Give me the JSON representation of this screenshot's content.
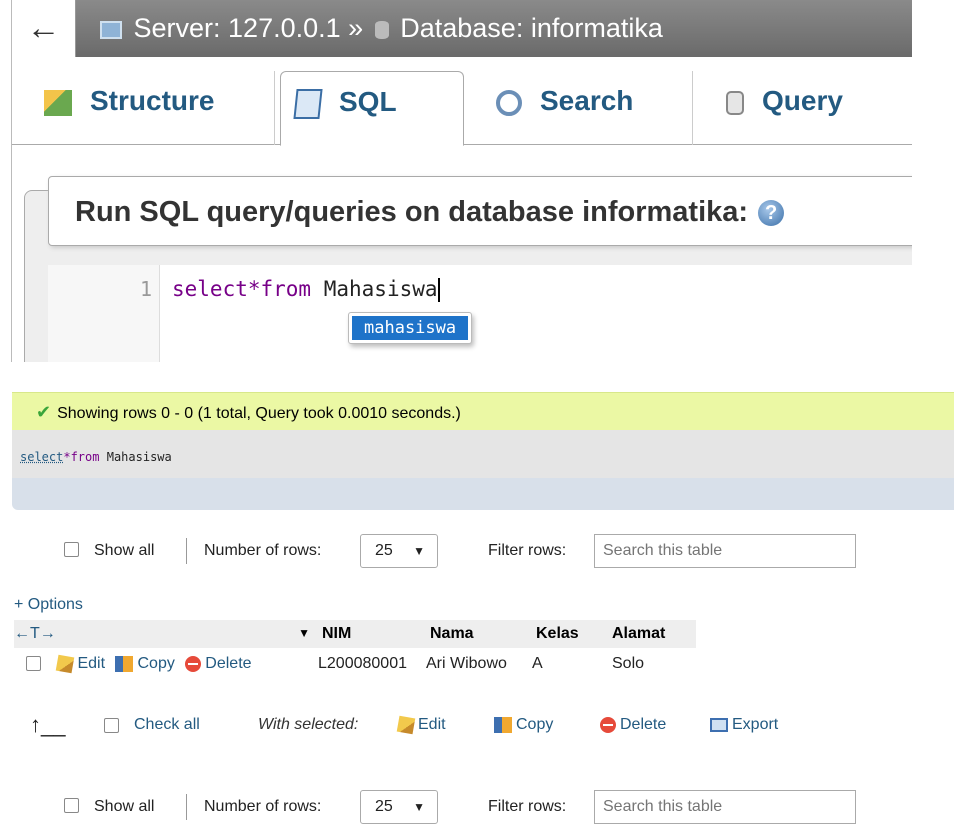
{
  "breadcrumb": {
    "back": "←",
    "server": "Server: 127.0.0.1",
    "sep": "»",
    "database": "Database: informatika"
  },
  "tabs": [
    {
      "label": "Structure",
      "icon": "structure-icon"
    },
    {
      "label": "SQL",
      "icon": "sql-icon",
      "active": true
    },
    {
      "label": "Search",
      "icon": "search-icon"
    },
    {
      "label": "Query",
      "icon": "query-icon"
    }
  ],
  "sql_panel": {
    "title": "Run SQL query/queries on database informatika:",
    "help": "?",
    "line_number": "1",
    "code_kw": "select*from",
    "code_table": "Mahasiswa",
    "autocomplete": "mahasiswa"
  },
  "result": {
    "message": "Showing rows 0 - 0 (1 total, Query took 0.0010 seconds.)",
    "sql_kw1": "select",
    "sql_kw2": "*from",
    "sql_table": "Mahasiswa"
  },
  "nav": {
    "show_all": "Show all",
    "number_of_rows": "Number of rows:",
    "rows_value": "25",
    "filter_rows": "Filter rows:",
    "filter_placeholder": "Search this table"
  },
  "options_link": "+ Options",
  "table": {
    "arrows": "←T→",
    "sort_indicator": "▼",
    "columns": [
      "NIM",
      "Nama",
      "Kelas",
      "Alamat"
    ],
    "rows": [
      {
        "edit": "Edit",
        "copy": "Copy",
        "delete": "Delete",
        "nim": "L200080001",
        "nama": "Ari Wibowo",
        "kelas": "A",
        "alamat": "Solo"
      }
    ]
  },
  "bulk": {
    "check_all": "Check all",
    "with_selected": "With selected:",
    "edit": "Edit",
    "copy": "Copy",
    "delete": "Delete",
    "export": "Export"
  },
  "colors": {
    "link": "#235a81",
    "success_bg": "#ebf8a4",
    "autocomplete_bg": "#1e73c9"
  }
}
